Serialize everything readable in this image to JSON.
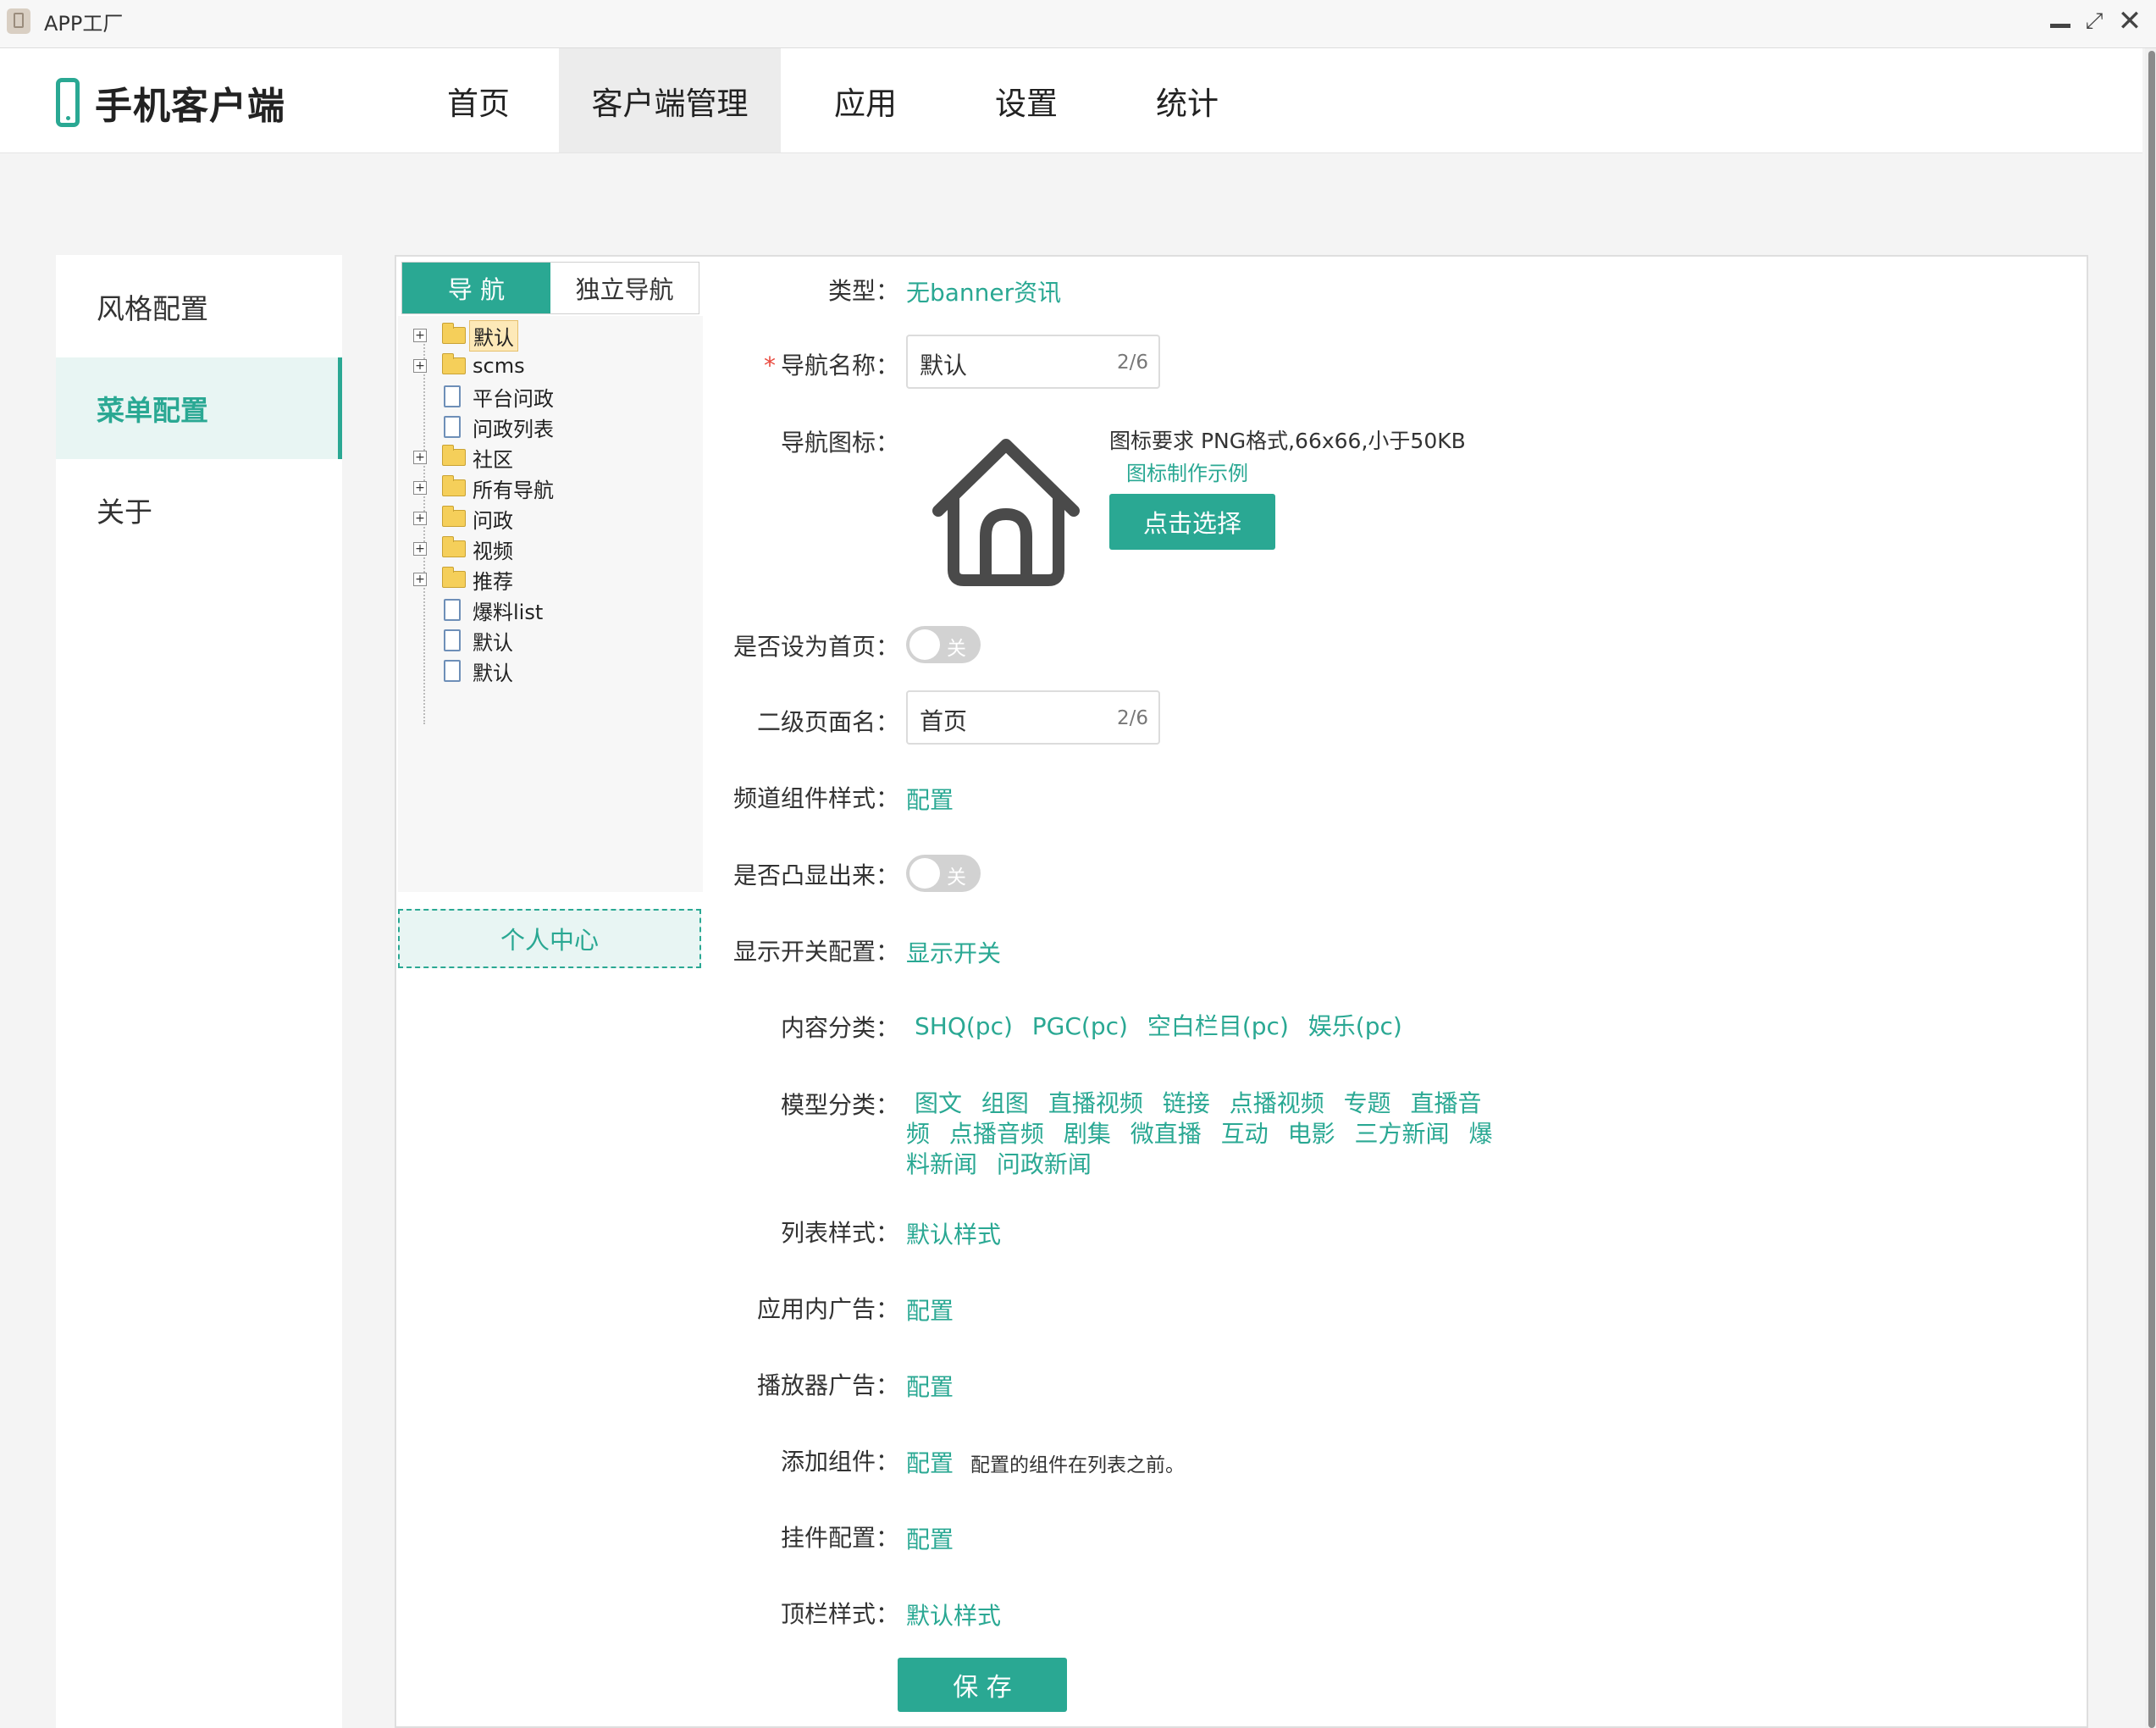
{
  "window": {
    "title": "APP工厂",
    "controls": {
      "minimize_icon": "minimize-icon",
      "maximize_icon": "maximize-icon",
      "close_icon": "close-icon",
      "maximize_glyph": "⤢",
      "close_glyph": "✕"
    }
  },
  "header": {
    "brand": "手机客户端",
    "brand_icon": "phone-icon",
    "nav": [
      "首页",
      "客户端管理",
      "应用",
      "设置",
      "统计"
    ],
    "active_nav": "客户端管理"
  },
  "sidebar": {
    "items": [
      "风格配置",
      "菜单配置",
      "关于"
    ],
    "active": "菜单配置"
  },
  "tree": {
    "tabs": [
      "导 航",
      "独立导航"
    ],
    "active_tab": "导 航",
    "nodes": [
      {
        "label": "默认",
        "type": "folder",
        "expand": "+",
        "selected": true
      },
      {
        "label": "scms",
        "type": "folder",
        "expand": "+"
      },
      {
        "label": "平台问政",
        "type": "file"
      },
      {
        "label": "问政列表",
        "type": "file"
      },
      {
        "label": "社区",
        "type": "folder",
        "expand": "+"
      },
      {
        "label": "所有导航",
        "type": "folder",
        "expand": "+"
      },
      {
        "label": "问政",
        "type": "folder",
        "expand": "+"
      },
      {
        "label": "视频",
        "type": "folder",
        "expand": "+"
      },
      {
        "label": "推荐",
        "type": "folder",
        "expand": "+"
      },
      {
        "label": "爆料list",
        "type": "file"
      },
      {
        "label": "默认",
        "type": "file"
      },
      {
        "label": "默认",
        "type": "file"
      }
    ],
    "personal_center": "个人中心"
  },
  "form": {
    "type_label": "类型",
    "type_value": "无banner资讯",
    "required_mark": "*",
    "nav_name_label": "导航名称",
    "nav_name_value": "默认",
    "nav_name_count": "2/6",
    "nav_icon_label": "导航图标",
    "nav_icon_name": "house-icon",
    "icon_req": "图标要求 PNG格式,66x66,小于50KB",
    "icon_example": "图标制作示例",
    "icon_select": "点击选择",
    "homepage_label": "是否设为首页",
    "homepage_toggle": "关",
    "second_page_label": "二级页面名",
    "second_page_value": "首页",
    "second_page_count": "2/6",
    "channel_style_label": "频道组件样式",
    "channel_style_link": "配置",
    "highlight_label": "是否凸显出来",
    "highlight_toggle": "关",
    "display_switch_label": "显示开关配置",
    "display_switch_link": "显示开关",
    "content_cat_label": "内容分类",
    "content_cats": [
      "SHQ(pc)",
      "PGC(pc)",
      "空白栏目(pc)",
      "娱乐(pc)"
    ],
    "model_cat_label": "模型分类",
    "model_cat_lines": [
      [
        "图文",
        "组图",
        "直播视频",
        "链接",
        "点播视频",
        "专题",
        "直播音"
      ],
      [
        "频",
        "点播音频",
        "剧集",
        "微直播",
        "互动",
        "电影",
        "三方新闻",
        "爆"
      ],
      [
        "料新闻",
        "问政新闻"
      ]
    ],
    "list_style_label": "列表样式",
    "list_style_link": "默认样式",
    "in_app_ad_label": "应用内广告",
    "in_app_ad_link": "配置",
    "player_ad_label": "播放器广告",
    "player_ad_link": "配置",
    "add_component_label": "添加组件",
    "add_component_link": "配置",
    "add_component_note": "配置的组件在列表之前。",
    "widget_label": "挂件配置",
    "widget_link": "配置",
    "topbar_label": "顶栏样式",
    "topbar_link": "默认样式",
    "save": "保 存"
  },
  "colors": {
    "accent": "#2aa893",
    "accent_light": "#e8f5f3",
    "required": "#e94a3f"
  }
}
